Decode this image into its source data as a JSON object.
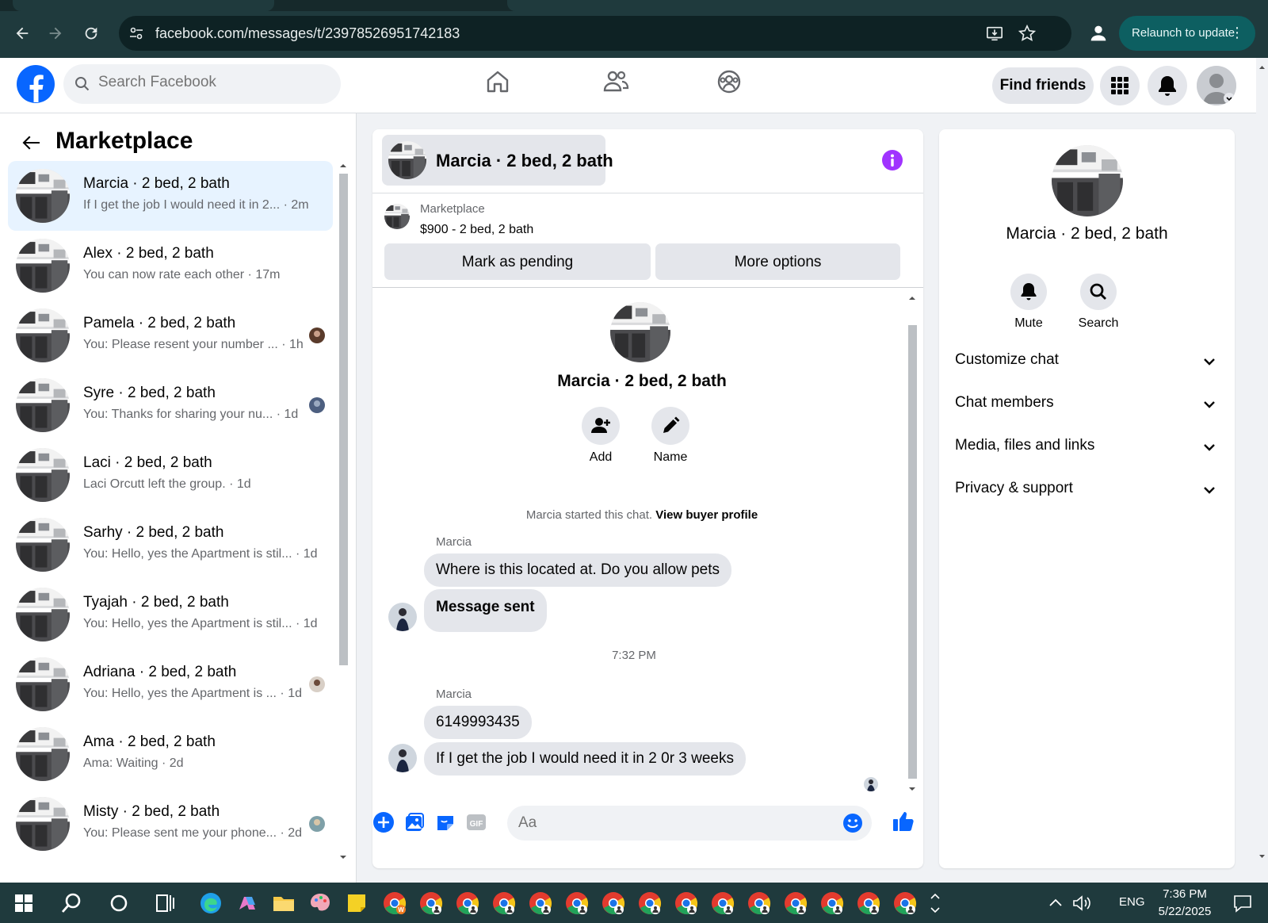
{
  "browser": {
    "url": "facebook.com/messages/t/23978526951742183",
    "relaunch_label": "Relaunch to update"
  },
  "topbar": {
    "search_placeholder": "Search Facebook",
    "find_friends_label": "Find friends"
  },
  "sidebar": {
    "title": "Marketplace",
    "conversations": [
      {
        "name": "Marcia · 2 bed, 2 bath",
        "snippet": "If I get the job I would need it in 2... · 2m",
        "active": true
      },
      {
        "name": "Alex · 2 bed, 2 bath",
        "snippet": "You can now rate each other · 17m"
      },
      {
        "name": "Pamela · 2 bed, 2 bath",
        "snippet": "You: Please resent your number ... · 1h"
      },
      {
        "name": "Syre · 2 bed, 2 bath",
        "snippet": "You: Thanks for sharing your nu... · 1d"
      },
      {
        "name": "Laci · 2 bed, 2 bath",
        "snippet": "Laci Orcutt left the group. · 1d"
      },
      {
        "name": "Sarhy · 2 bed, 2 bath",
        "snippet": "You: Hello, yes the Apartment is stil... · 1d"
      },
      {
        "name": "Tyajah · 2 bed, 2 bath",
        "snippet": "You: Hello, yes the Apartment is stil... · 1d"
      },
      {
        "name": "Adriana · 2 bed, 2 bath",
        "snippet": "You: Hello, yes the Apartment is ... · 1d"
      },
      {
        "name": "Ama · 2 bed, 2 bath",
        "snippet": "Ama: Waiting · 2d"
      },
      {
        "name": "Misty · 2 bed, 2 bath",
        "snippet": "You: Please sent me your phone... · 2d"
      }
    ]
  },
  "chat": {
    "title": "Marcia · 2 bed, 2 bath",
    "listing": {
      "label": "Marketplace",
      "price_title": "$900 - 2 bed, 2 bath",
      "mark_pending_label": "Mark as pending",
      "more_options_label": "More options"
    },
    "intro": {
      "name": "Marcia · 2 bed, 2 bath",
      "add_label": "Add",
      "name_label": "Name",
      "started_text": "Marcia started this chat.",
      "view_profile_label": "View buyer profile"
    },
    "messages": [
      {
        "sender": "Marcia",
        "text": "Where is this located at. Do you allow pets"
      },
      {
        "text": "Message sent"
      },
      {
        "timestamp": "7:32 PM"
      },
      {
        "sender": "Marcia",
        "text": "6149993435"
      },
      {
        "text": "If I get the job I would need it in 2 0r 3 weeks"
      }
    ],
    "composer_placeholder": "Aa"
  },
  "info_panel": {
    "name": "Marcia · 2 bed, 2 bath",
    "mute_label": "Mute",
    "search_label": "Search",
    "sections": [
      "Customize chat",
      "Chat members",
      "Media, files and links",
      "Privacy & support"
    ]
  },
  "taskbar": {
    "lang": "ENG",
    "time": "7:36 PM",
    "date": "5/22/2025"
  },
  "colors": {
    "fb_blue": "#0866ff",
    "active_bg": "#e7f3ff",
    "info_purple": "#a033ff",
    "chrome_bg": "#1f3a3d"
  }
}
